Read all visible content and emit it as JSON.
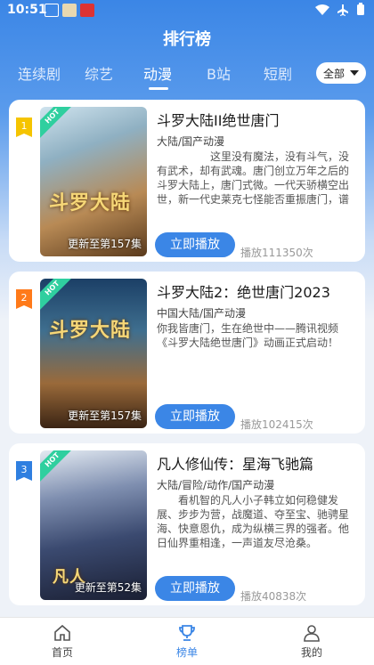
{
  "status": {
    "time": "10:51"
  },
  "header": {
    "title": "排行榜"
  },
  "tabs": [
    {
      "label": "连续剧"
    },
    {
      "label": "综艺"
    },
    {
      "label": "动漫"
    },
    {
      "label": "B站"
    },
    {
      "label": "短剧"
    }
  ],
  "active_tab": "动漫",
  "filter": {
    "label": "全部"
  },
  "items": [
    {
      "rank": "1",
      "hot": "HOT",
      "title": "斗罗大陆II绝世唐门",
      "genre": "大陆/国产动漫",
      "description": "这里没有魔法，没有斗气，没有武术，却有武魂。唐门创立万年之后的斗罗大陆上，唐门式微。一代天骄横空出世，新一代史莱克七怪能否重振唐门，谱写一曲绝世唐门之歌？",
      "episodes": "更新至第157集",
      "cover_text": "斗罗大陆",
      "play_label": "立即播放",
      "play_count": "播放111350次",
      "rank_color": "#f5c400"
    },
    {
      "rank": "2",
      "hot": "HOT",
      "title": "斗罗大陆2：绝世唐门2023",
      "genre": "中国大陆/国产动漫",
      "description": "你我皆唐门，生在绝世中——腾讯视频《斗罗大陆绝世唐门》动画正式启动！",
      "episodes": "更新至第157集",
      "cover_text": "斗罗大陆",
      "play_label": "立即播放",
      "play_count": "播放102415次",
      "rank_color": "#ff7a1a"
    },
    {
      "rank": "3",
      "hot": "HOT",
      "title": "凡人修仙传：星海飞驰篇",
      "genre": "大陆/冒险/动作/国产动漫",
      "description": "看机智的凡人小子韩立如何稳健发展、步步为营，战魔道、夺至宝、驰骋星海、快意恩仇，成为纵横三界的强者。他日仙界重相逢，一声道友尽沧桑。",
      "episodes": "更新至第52集",
      "cover_text": "凡人",
      "play_label": "立即播放",
      "play_count": "播放40838次",
      "rank_color": "#2f7fe0"
    }
  ],
  "bottom_nav": [
    {
      "label": "首页",
      "icon": "home-icon"
    },
    {
      "label": "榜单",
      "icon": "trophy-icon"
    },
    {
      "label": "我的",
      "icon": "user-icon"
    }
  ],
  "colors": {
    "primary": "#3b86e6",
    "hot_badge": "#2fcf9f"
  }
}
